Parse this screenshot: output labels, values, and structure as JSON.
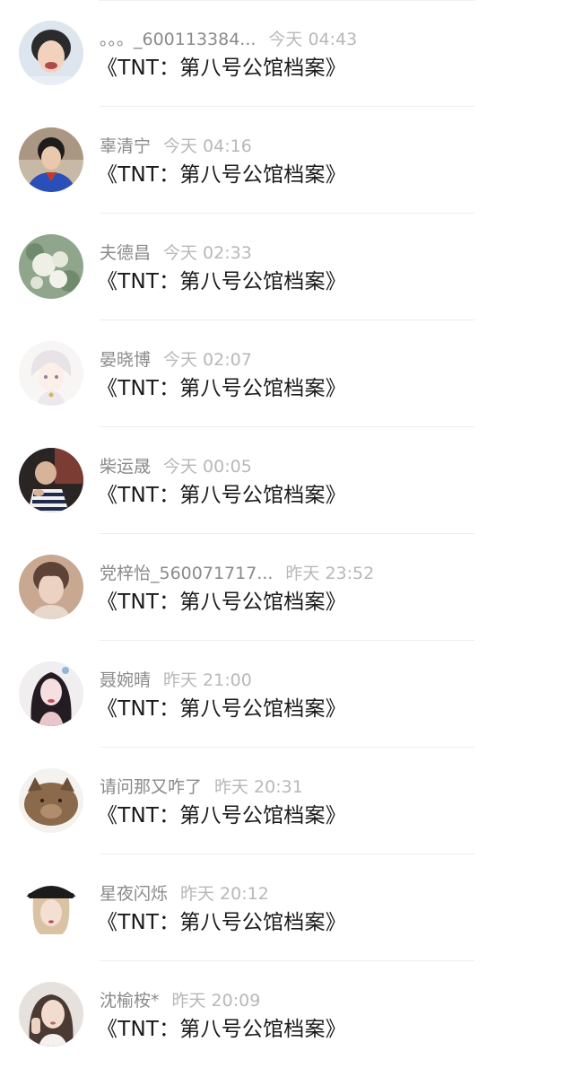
{
  "comments": [
    {
      "username": "。。。_600113384...",
      "time": "今天 04:43",
      "text": "《TNT：第八号公馆档案》",
      "avatar": "avatar-boy-smiling-icon"
    },
    {
      "username": "辜清宁",
      "time": "今天 04:16",
      "text": "《TNT：第八号公馆档案》",
      "avatar": "avatar-boy-blue-shirt-icon"
    },
    {
      "username": "夫德昌",
      "time": "今天 02:33",
      "text": "《TNT：第八号公馆档案》",
      "avatar": "avatar-white-flowers-icon"
    },
    {
      "username": "晏晓博",
      "time": "今天 02:07",
      "text": "《TNT：第八号公馆档案》",
      "avatar": "avatar-anime-white-hair-icon"
    },
    {
      "username": "柴运晟",
      "time": "今天 00:05",
      "text": "《TNT：第八号公馆档案》",
      "avatar": "avatar-person-striped-shirt-icon"
    },
    {
      "username": "党梓怡_560071717...",
      "time": "昨天 23:52",
      "text": "《TNT：第八号公馆档案》",
      "avatar": "avatar-boy-portrait-icon"
    },
    {
      "username": "聂婉晴",
      "time": "昨天 21:00",
      "text": "《TNT：第八号公馆档案》",
      "avatar": "avatar-girl-long-hair-icon"
    },
    {
      "username": "请问那又咋了",
      "time": "昨天 20:31",
      "text": "《TNT：第八号公馆档案》",
      "avatar": "avatar-cat-icon"
    },
    {
      "username": "星夜闪烁",
      "time": "昨天 20:12",
      "text": "《TNT：第八号公馆档案》",
      "avatar": "avatar-girl-black-cap-icon"
    },
    {
      "username": "沈榆桉*",
      "time": "昨天 20:09",
      "text": "《TNT：第八号公馆档案》",
      "avatar": "avatar-girl-selfie-icon"
    }
  ],
  "colors": {
    "username": "#8a8a8a",
    "timestamp": "#b8b8b8",
    "text": "#1a1a1a",
    "divider": "#eeeeee"
  }
}
